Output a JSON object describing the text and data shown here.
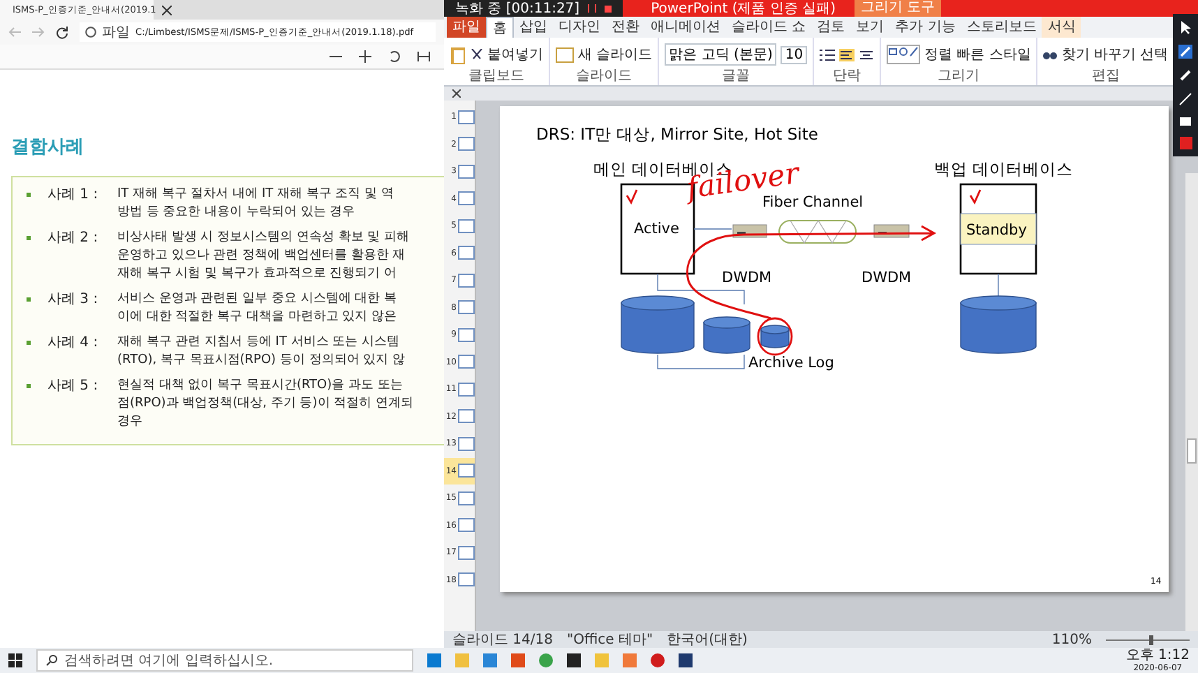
{
  "browser": {
    "tab_title": "ISMS-P_인증기준_안내서(2019.1",
    "address_label": "파일",
    "address": "C:/Limbest/ISMS문제/ISMS-P_인증기준_안내서(2019.1.18).pdf",
    "heading": "결함사례",
    "cases": [
      {
        "label": "사례 1 :",
        "lines": [
          "IT 재해 복구 절차서 내에 IT 재해 복구 조직 및 역",
          "방법 등 중요한 내용이 누락되어 있는 경우"
        ]
      },
      {
        "label": "사례 2 :",
        "lines": [
          "비상사태 발생 시 정보시스템의 연속성 확보 및 피해",
          "운영하고 있으나 관련 정책에 백업센터를 활용한 재",
          "재해 복구 시험 및 복구가 효과적으로 진행되기 어"
        ]
      },
      {
        "label": "사례 3 :",
        "lines": [
          "서비스 운영과 관련된 일부 중요 시스템에 대한 복",
          "이에 대한 적절한 복구 대책을 마련하고 있지 않은"
        ]
      },
      {
        "label": "사례 4 :",
        "lines": [
          "재해 복구 관련 지침서 등에 IT 서비스 또는 시스템",
          "(RTO), 복구 목표시점(RPO) 등이 정의되어 있지 않"
        ]
      },
      {
        "label": "사례 5 :",
        "lines": [
          "현실적 대책 없이 복구 목표시간(RTO)을 과도 또는",
          "점(RPO)과 백업정책(대상, 주기 등)이 적절히 연계되",
          "경우"
        ]
      }
    ]
  },
  "ppt": {
    "recording": "녹화 중 [00:11:27]",
    "title": "PowerPoint (제품 인증 실패)",
    "context_tab": "그리기 도구",
    "tabs": [
      {
        "label": "파일",
        "selected": false,
        "kind": "file"
      },
      {
        "label": "홈",
        "selected": true,
        "kind": "tab"
      },
      {
        "label": "삽입",
        "selected": false,
        "kind": "tab"
      },
      {
        "label": "디자인",
        "selected": false,
        "kind": "tab"
      },
      {
        "label": "전환",
        "selected": false,
        "kind": "tab"
      },
      {
        "label": "애니메이션",
        "selected": false,
        "kind": "tab"
      },
      {
        "label": "슬라이드 쇼",
        "selected": false,
        "kind": "tab"
      },
      {
        "label": "검토",
        "selected": false,
        "kind": "tab"
      },
      {
        "label": "보기",
        "selected": false,
        "kind": "tab"
      },
      {
        "label": "추가 기능",
        "selected": false,
        "kind": "tab"
      },
      {
        "label": "스토리보드",
        "selected": false,
        "kind": "tab"
      },
      {
        "label": "서식",
        "selected": false,
        "kind": "context"
      }
    ],
    "groups": [
      {
        "label": "클립보드",
        "kind": "clipboard",
        "buttons": [
          "붙여넣기"
        ]
      },
      {
        "label": "슬라이드",
        "kind": "slides",
        "buttons": [
          "새 슬라이드"
        ]
      },
      {
        "label": "글꼴",
        "kind": "font",
        "font_name": "맑은 고딕 (본문)",
        "font_size": "10"
      },
      {
        "label": "단락",
        "kind": "paragraph"
      },
      {
        "label": "그리기",
        "kind": "drawing",
        "buttons": [
          "정렬",
          "빠른 스타일"
        ]
      },
      {
        "label": "편집",
        "kind": "editing",
        "buttons": [
          "찾기",
          "바꾸기",
          "선택"
        ]
      }
    ],
    "thumbnails": [
      {
        "number": "1",
        "selected": false
      },
      {
        "number": "2",
        "selected": false
      },
      {
        "number": "3",
        "selected": false
      },
      {
        "number": "4",
        "selected": false
      },
      {
        "number": "5",
        "selected": false
      },
      {
        "number": "6",
        "selected": false
      },
      {
        "number": "7",
        "selected": false
      },
      {
        "number": "8",
        "selected": false
      },
      {
        "number": "9",
        "selected": false
      },
      {
        "number": "10",
        "selected": false
      },
      {
        "number": "11",
        "selected": false
      },
      {
        "number": "12",
        "selected": false
      },
      {
        "number": "13",
        "selected": false
      },
      {
        "number": "14",
        "selected": true
      },
      {
        "number": "15",
        "selected": false
      },
      {
        "number": "16",
        "selected": false
      },
      {
        "number": "17",
        "selected": false
      },
      {
        "number": "18",
        "selected": false
      }
    ],
    "slide": {
      "title": "DRS: IT만 대상, Mirror Site, Hot Site",
      "main_label": "메인 데이터베이스",
      "backup_label": "백업 데이터베이스",
      "active": "Active",
      "standby": "Standby",
      "fiber": "Fiber Channel",
      "dwdm_left": "DWDM",
      "dwdm_right": "DWDM",
      "archive": "Archive Log",
      "annotation": "failover",
      "page_number": "14"
    },
    "status": {
      "slide": "슬라이드 14/18",
      "theme": "\"Office 테마\"",
      "language": "한국어(대한)",
      "zoom": "110%",
      "zoom_slider": {
        "level": 0.55
      }
    }
  },
  "taskbar": {
    "search_placeholder": "검색하려면 여기에 입력하십시오.",
    "time": "오후 1:12",
    "date": "2020-06-07"
  }
}
